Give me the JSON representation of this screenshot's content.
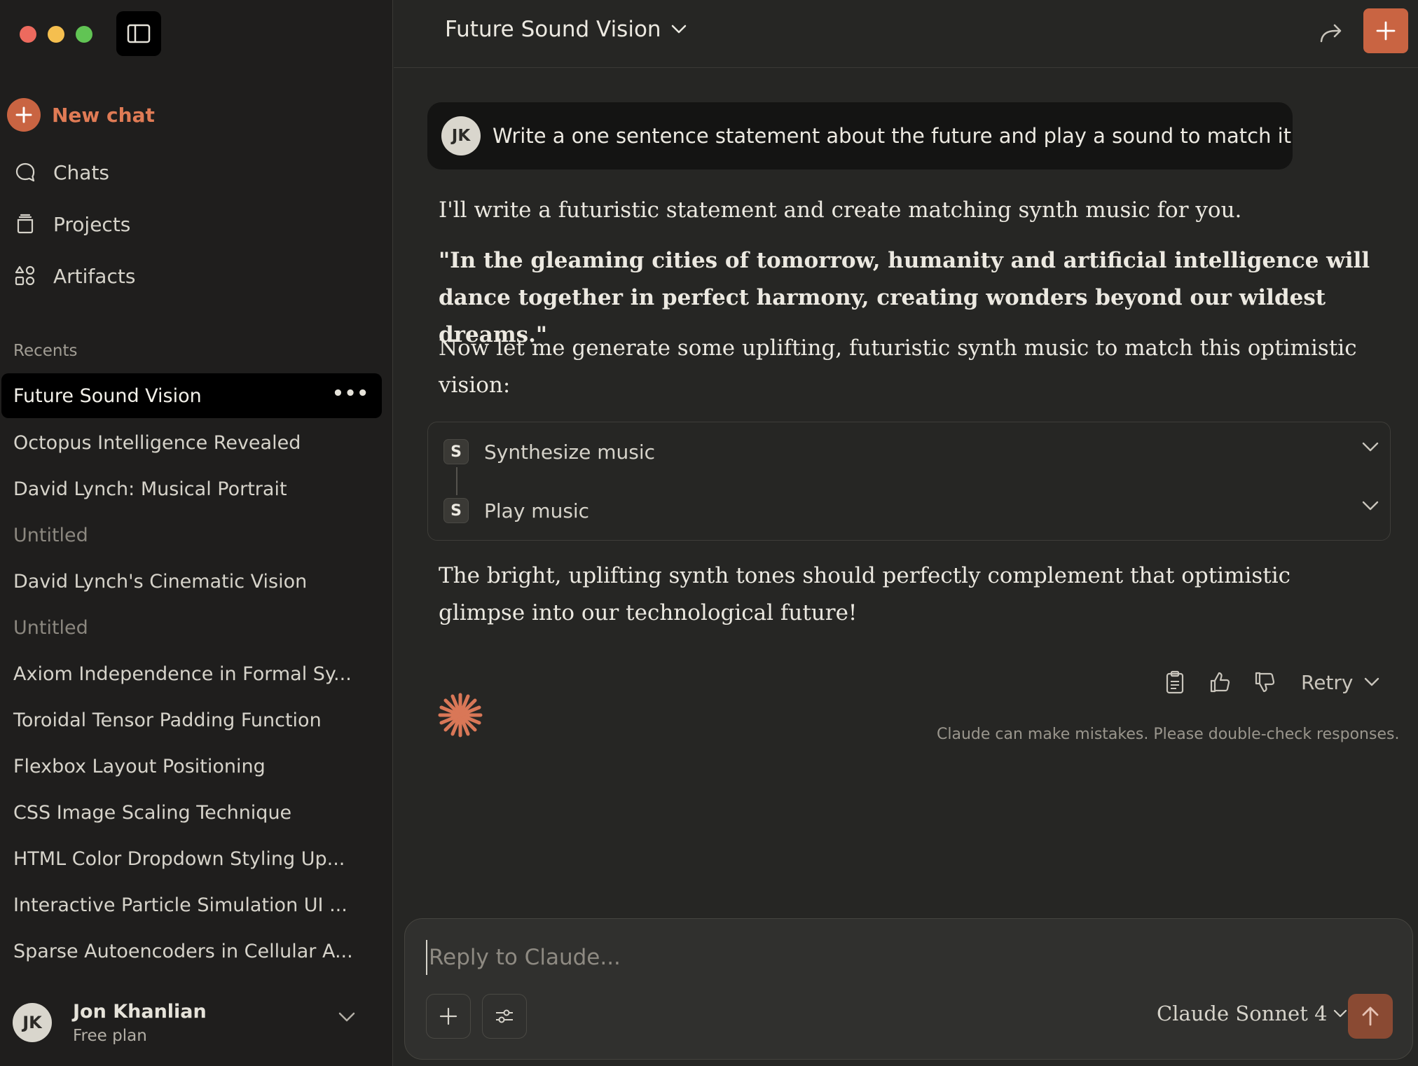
{
  "colors": {
    "accent": "#c96442",
    "sidebar_bg": "#1f1e1d",
    "main_bg": "#262624",
    "active_item_bg": "#000000",
    "traffic_red": "#ed6a5e",
    "traffic_yellow": "#f5bf4f",
    "traffic_green": "#61c454"
  },
  "sidebar": {
    "new_chat_label": "New chat",
    "nav": [
      {
        "label": "Chats",
        "icon": "chat-bubble-icon"
      },
      {
        "label": "Projects",
        "icon": "projects-icon"
      },
      {
        "label": "Artifacts",
        "icon": "artifacts-icon"
      }
    ],
    "recents_heading": "Recents",
    "recents": [
      {
        "label": "Future Sound Vision",
        "active": true
      },
      {
        "label": "Octopus Intelligence Revealed"
      },
      {
        "label": "David Lynch: Musical Portrait"
      },
      {
        "label": "Untitled",
        "muted": true
      },
      {
        "label": "David Lynch's Cinematic Vision"
      },
      {
        "label": "Untitled",
        "muted": true
      },
      {
        "label": "Axiom Independence in Formal Sy..."
      },
      {
        "label": "Toroidal Tensor Padding Function"
      },
      {
        "label": "Flexbox Layout Positioning"
      },
      {
        "label": "CSS Image Scaling Technique"
      },
      {
        "label": "HTML Color Dropdown Styling Up..."
      },
      {
        "label": "Interactive Particle Simulation UI ..."
      },
      {
        "label": "Sparse Autoencoders in Cellular A..."
      }
    ],
    "user": {
      "initials": "JK",
      "name": "Jon Khanlian",
      "plan": "Free plan"
    }
  },
  "header": {
    "title": "Future Sound Vision"
  },
  "conversation": {
    "user_initials": "JK",
    "user_message": "Write a one sentence statement about the future and play a sound to match it",
    "assistant_intro": "I'll write a futuristic statement and create matching synth music for you.",
    "assistant_quote": "\"In the gleaming cities of tomorrow, humanity and artificial intelligence will dance together in perfect harmony, creating wonders beyond our wildest dreams.\"",
    "assistant_lead": "Now let me generate some uplifting, futuristic synth music to match this optimistic vision:",
    "tools": [
      {
        "badge": "S",
        "label": "Synthesize music"
      },
      {
        "badge": "S",
        "label": "Play music"
      }
    ],
    "assistant_closing": "The bright, uplifting synth tones should perfectly complement that optimistic glimpse into our technological future!",
    "retry_label": "Retry",
    "disclaimer": "Claude can make mistakes. Please double-check responses."
  },
  "composer": {
    "placeholder": "Reply to Claude...",
    "model": "Claude Sonnet 4"
  }
}
